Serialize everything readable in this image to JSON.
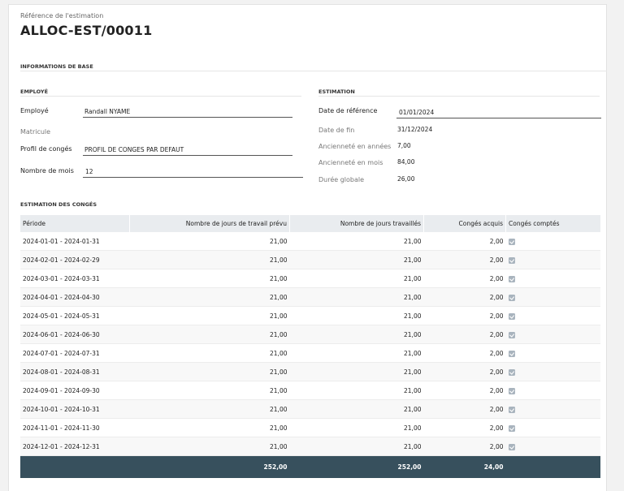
{
  "header": {
    "ref_label": "Référence de l'estimation",
    "ref_value": "ALLOC-EST/00011"
  },
  "sections": {
    "base": "INFORMATIONS DE BASE",
    "employee": "EMPLOYÉ",
    "estimation": "ESTIMATION",
    "leaves": "ESTIMATION DES CONGÉS"
  },
  "employee": {
    "employee_label": "Employé",
    "employee_value": "Randall NYAME",
    "matricule_label": "Matricule",
    "profile_label": "Profil de congés",
    "profile_value": "PROFIL DE CONGES PAR DEFAUT",
    "months_label": "Nombre de mois",
    "months_value": "12"
  },
  "estimation": {
    "ref_date_label": "Date de référence",
    "ref_date_value": "01/01/2024",
    "end_date_label": "Date de fin",
    "end_date_value": "31/12/2024",
    "seniority_years_label": "Ancienneté en années",
    "seniority_years_value": "7,00",
    "seniority_months_label": "Ancienneté en mois",
    "seniority_months_value": "84,00",
    "duration_label": "Durée globale",
    "duration_value": "26,00"
  },
  "table": {
    "columns": [
      "Période",
      "Nombre de jours de travail prévu",
      "Nombre de jours travaillés",
      "Congés acquis",
      "Congés comptés"
    ],
    "rows": [
      {
        "period": "2024-01-01 - 2024-01-31",
        "planned": "21,00",
        "worked": "21,00",
        "acquired": "2,00",
        "counted": true
      },
      {
        "period": "2024-02-01 - 2024-02-29",
        "planned": "21,00",
        "worked": "21,00",
        "acquired": "2,00",
        "counted": true
      },
      {
        "period": "2024-03-01 - 2024-03-31",
        "planned": "21,00",
        "worked": "21,00",
        "acquired": "2,00",
        "counted": true
      },
      {
        "period": "2024-04-01 - 2024-04-30",
        "planned": "21,00",
        "worked": "21,00",
        "acquired": "2,00",
        "counted": true
      },
      {
        "period": "2024-05-01 - 2024-05-31",
        "planned": "21,00",
        "worked": "21,00",
        "acquired": "2,00",
        "counted": true
      },
      {
        "period": "2024-06-01 - 2024-06-30",
        "planned": "21,00",
        "worked": "21,00",
        "acquired": "2,00",
        "counted": true
      },
      {
        "period": "2024-07-01 - 2024-07-31",
        "planned": "21,00",
        "worked": "21,00",
        "acquired": "2,00",
        "counted": true
      },
      {
        "period": "2024-08-01 - 2024-08-31",
        "planned": "21,00",
        "worked": "21,00",
        "acquired": "2,00",
        "counted": true
      },
      {
        "period": "2024-09-01 - 2024-09-30",
        "planned": "21,00",
        "worked": "21,00",
        "acquired": "2,00",
        "counted": true
      },
      {
        "period": "2024-10-01 - 2024-10-31",
        "planned": "21,00",
        "worked": "21,00",
        "acquired": "2,00",
        "counted": true
      },
      {
        "period": "2024-11-01 - 2024-11-30",
        "planned": "21,00",
        "worked": "21,00",
        "acquired": "2,00",
        "counted": true
      },
      {
        "period": "2024-12-01 - 2024-12-31",
        "planned": "21,00",
        "worked": "21,00",
        "acquired": "2,00",
        "counted": true
      }
    ],
    "totals": {
      "planned": "252,00",
      "worked": "252,00",
      "acquired": "24,00"
    }
  },
  "colors": {
    "total_bg": "#37505d",
    "header_bg": "#e9ecef",
    "checkbox": "#a9b4be"
  }
}
